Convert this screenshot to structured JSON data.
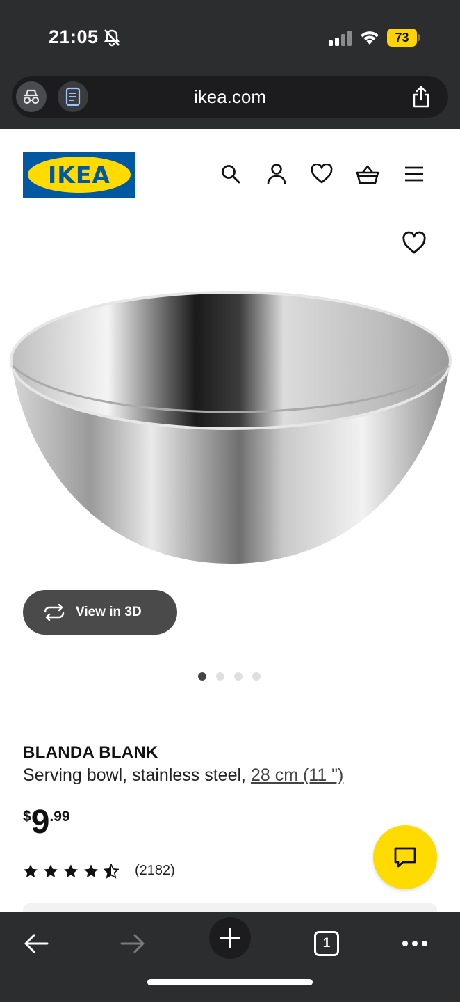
{
  "status_bar": {
    "time": "21:05",
    "battery_level": "73",
    "icons": [
      "bell-muted-icon",
      "signal-icon",
      "wifi-icon",
      "battery-icon"
    ],
    "battery_color": "#ffd400"
  },
  "browser": {
    "url": "ikea.com",
    "icons": [
      "incognito-icon",
      "reader-icon",
      "share-icon"
    ]
  },
  "header": {
    "logo_text": "IKEA",
    "icons": [
      "search-icon",
      "account-icon",
      "heart-icon",
      "basket-icon",
      "menu-icon"
    ],
    "brand_blue": "#0058a3",
    "brand_yellow": "#ffdb00"
  },
  "gallery": {
    "view_3d_label": "View in 3D",
    "image_count": 4,
    "active_index": 0
  },
  "product": {
    "name": "BLANDA BLANK",
    "description": "Serving bowl, stainless steel, ",
    "size": "28 cm (11 \")",
    "price_currency": "$",
    "price_integer": "9",
    "price_decimal": ".99",
    "rating_stars": 4.5,
    "rating_count": "(2182)"
  },
  "chat": {
    "icon": "chat-icon"
  },
  "toolbar": {
    "tab_count": "1",
    "icons": [
      "back-arrow-icon",
      "forward-arrow-icon",
      "new-tab-plus-icon",
      "tabs-icon",
      "more-icon"
    ]
  }
}
